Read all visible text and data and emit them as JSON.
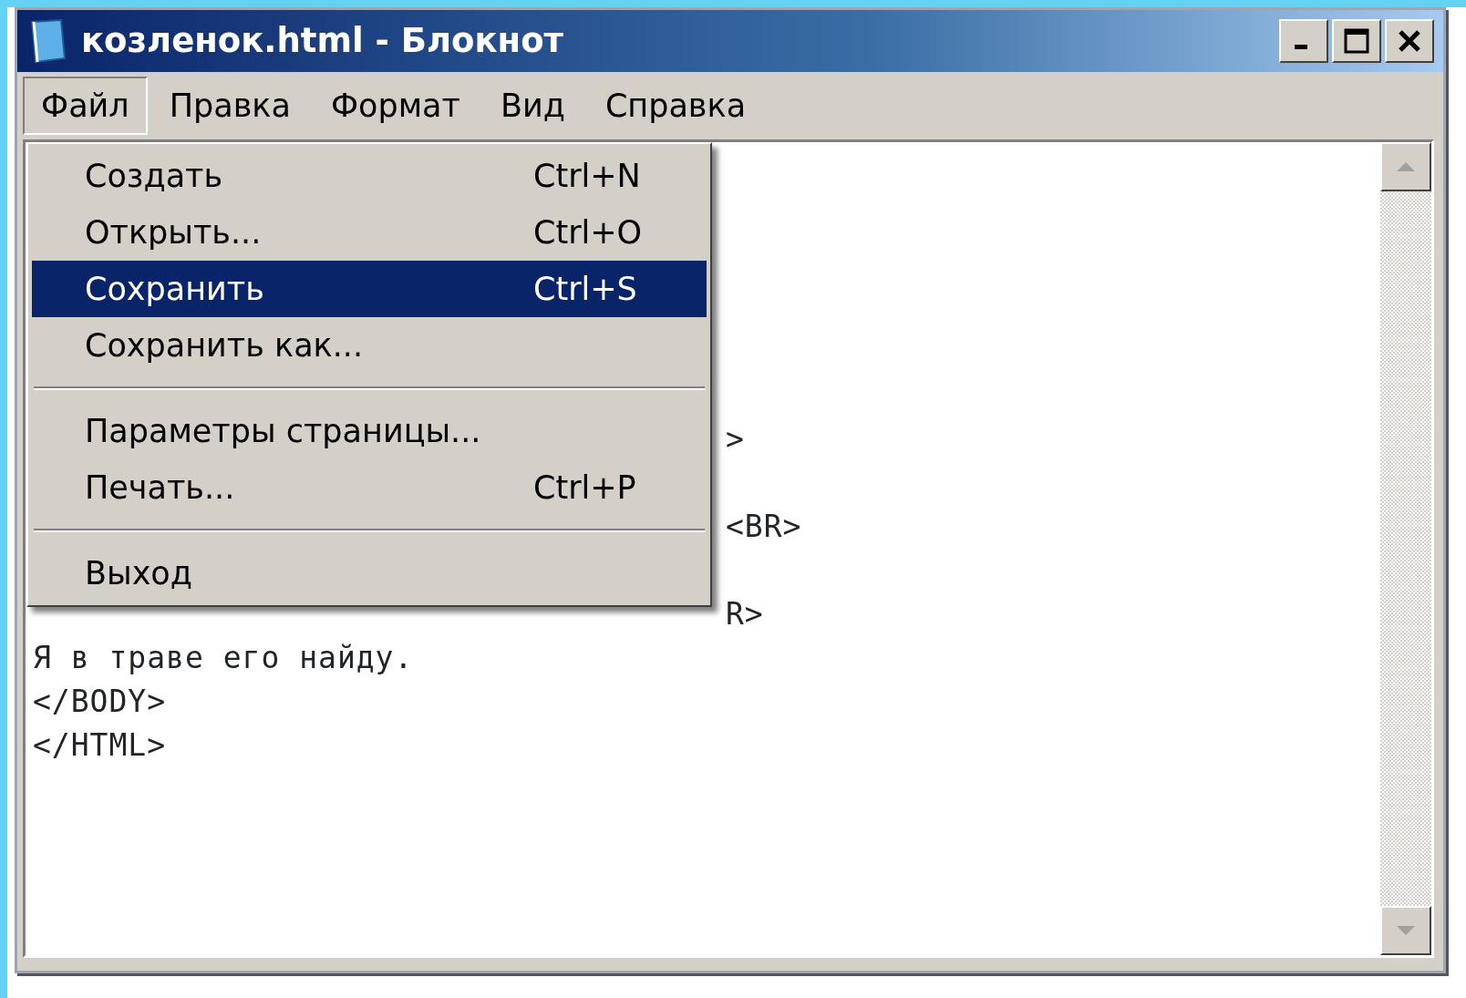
{
  "window": {
    "title": "козленок.html - Блокнот"
  },
  "menu_bar": [
    {
      "label": "Файл",
      "selected": true
    },
    {
      "label": "Правка",
      "selected": false
    },
    {
      "label": "Формат",
      "selected": false
    },
    {
      "label": "Вид",
      "selected": false
    },
    {
      "label": "Справка",
      "selected": false
    }
  ],
  "file_menu": [
    {
      "kind": "item",
      "label": "Создать",
      "shortcut": "Ctrl+N",
      "selected": false
    },
    {
      "kind": "item",
      "label": "Открыть...",
      "shortcut": "Ctrl+O",
      "selected": false
    },
    {
      "kind": "item",
      "label": "Сохранить",
      "shortcut": "Ctrl+S",
      "selected": true
    },
    {
      "kind": "item",
      "label": "Сохранить как...",
      "selected": false
    },
    {
      "kind": "separator"
    },
    {
      "kind": "item",
      "label": "Параметры страницы...",
      "selected": false
    },
    {
      "kind": "item",
      "label": "Печать...",
      "shortcut": "Ctrl+P",
      "selected": false
    },
    {
      "kind": "separator"
    },
    {
      "kind": "item",
      "label": "Выход",
      "selected": false
    }
  ],
  "editor_lines": [
    {
      "kind": "partial",
      "text": ">"
    },
    {
      "kind": "hidden"
    },
    {
      "kind": "partial",
      "text": "<BR>"
    },
    {
      "kind": "hidden"
    },
    {
      "kind": "partial",
      "text": "R>"
    },
    {
      "kind": "full",
      "text": "Я в траве его найду."
    },
    {
      "kind": "full",
      "text": "</BODY>"
    },
    {
      "kind": "full",
      "text": "</HTML>"
    }
  ]
}
